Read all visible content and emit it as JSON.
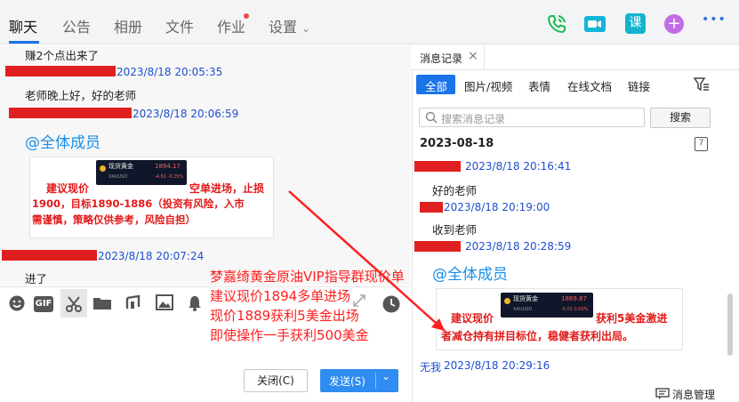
{
  "tabs": [
    "聊天",
    "公告",
    "相册",
    "文件",
    "作业",
    "设置"
  ],
  "settings_chevron": "⌄",
  "header_icons": {
    "phone": "phone-icon",
    "video": "video-icon",
    "course_label": "课",
    "add": "plus-icon",
    "more": "•••"
  },
  "chat": {
    "messages": [
      {
        "text": "赚2个点出来了"
      },
      {
        "time": "2023/8/18 20:05:35"
      },
      {
        "text": "老师晚上好，好的老师"
      },
      {
        "time": "2023/8/18 20:06:59"
      },
      {
        "atall": "@全体成员"
      },
      {
        "time": "2023/8/18 20:07:24"
      },
      {
        "text": "进了"
      }
    ],
    "card": {
      "ticker_name": "现货黄金",
      "ticker_code": "XAUUSD",
      "ticker_price": "1894.17",
      "ticker_change": "-4.61  -0.25%",
      "line1_left": "建议现价",
      "line1_right": "空单进场，止损",
      "line2": "1900，目标1890-1886（投资有风险，入市",
      "line3": "需谨慎，策略仅供参考，风险自担）"
    }
  },
  "annotation": {
    "lines": [
      "梦嘉绮黄金原油VIP指导群现价单",
      "建议现价1894多单进场",
      "现价1889获利5美金出场",
      "即使操作一手获利500美金"
    ]
  },
  "toolbar": {
    "icons": [
      "emoji-icon",
      "gif-icon",
      "scissors-icon",
      "folder-icon",
      "music-icon",
      "image-icon",
      "bell-icon",
      "expand-icon",
      "clock-icon"
    ],
    "gif_label": "GIF"
  },
  "footer": {
    "close_label": "关闭(C)",
    "send_label": "发送(S)",
    "send_arrow": "⌄"
  },
  "history": {
    "panel_title": "消息记录",
    "close_glyph": "×",
    "filter_tabs": [
      "全部",
      "图片/视频",
      "表情",
      "在线文档",
      "链接"
    ],
    "search_placeholder": "搜索消息记录",
    "search_button": "搜索",
    "date": "2023-08-18",
    "calendar_glyph": "7",
    "entries": [
      {
        "time": "2023/8/18 20:16:41",
        "text": "好的老师"
      },
      {
        "time": "2023/8/18 20:19:00",
        "text": "收到老师"
      },
      {
        "time": "2023/8/18 20:28:59",
        "atall": "@全体成员"
      }
    ],
    "card": {
      "ticker_name": "现货黄金",
      "ticker_code": "XAUUSD",
      "ticker_price": "1889.87",
      "ticker_change": "-0.01  0.00%",
      "line1_left": "建议现价",
      "line1_right": "获利5美金激进",
      "line2": "者减仓持有拼目标位，稳健者获利出局。"
    },
    "last_sender": "无我",
    "last_time": "2023/8/18 20:29:16",
    "manage_label": "消息管理"
  },
  "colors": {
    "accent": "#1a73e8",
    "send_button": "#2f8cf0",
    "time_text": "#1f4fcf",
    "annotation_red": "#ff1e1e",
    "phone_green": "#1db954",
    "video_teal": "#13b5d8",
    "add_purple": "#c26be6"
  }
}
